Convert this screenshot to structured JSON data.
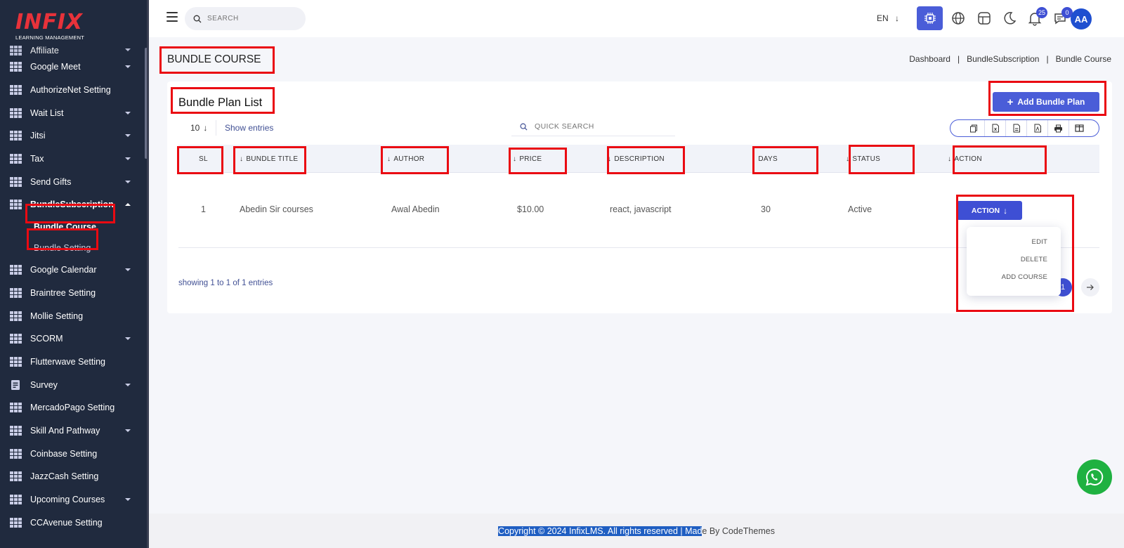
{
  "logo": {
    "word": "INFIX",
    "subtitle": "LEARNING MANAGEMENT"
  },
  "sidebar": {
    "items": [
      {
        "label": "Affiliate",
        "caret": true
      },
      {
        "label": "Google Meet",
        "caret": true
      },
      {
        "label": "AuthorizeNet Setting",
        "caret": false
      },
      {
        "label": "Wait List",
        "caret": true
      },
      {
        "label": "Jitsi",
        "caret": true
      },
      {
        "label": "Tax",
        "caret": true
      },
      {
        "label": "Send Gifts",
        "caret": true
      },
      {
        "label": "BundleSubscription",
        "caret": true,
        "expanded": true
      },
      {
        "label": "Google Calendar",
        "caret": true
      },
      {
        "label": "Braintree Setting",
        "caret": false
      },
      {
        "label": "Mollie Setting",
        "caret": false
      },
      {
        "label": "SCORM",
        "caret": true
      },
      {
        "label": "Flutterwave Setting",
        "caret": false
      },
      {
        "label": "Survey",
        "caret": true
      },
      {
        "label": "MercadoPago Setting",
        "caret": false
      },
      {
        "label": "Skill And Pathway",
        "caret": true
      },
      {
        "label": "Coinbase Setting",
        "caret": false
      },
      {
        "label": "JazzCash Setting",
        "caret": false
      },
      {
        "label": "Upcoming Courses",
        "caret": true
      },
      {
        "label": "CCAvenue Setting",
        "caret": false
      }
    ],
    "subitems": [
      {
        "label": "Bundle Course",
        "active": true
      },
      {
        "label": "Bundle Setting",
        "active": false
      }
    ]
  },
  "topbar": {
    "search_placeholder": "SEARCH",
    "language": "EN",
    "notifications_count": "25",
    "messages_count": "0",
    "avatar_initials": "AA"
  },
  "page": {
    "title": "BUNDLE COURSE",
    "breadcrumbs": [
      "Dashboard",
      "BundleSubscription",
      "Bundle Course"
    ]
  },
  "card": {
    "title": "Bundle Plan List",
    "add_button": "Add Bundle Plan",
    "entries_value": "10",
    "entries_label": "Show entries",
    "quick_search_placeholder": "QUICK SEARCH",
    "columns": [
      "SL",
      "BUNDLE TITLE",
      "AUTHOR",
      "PRICE",
      "DESCRIPTION",
      "DAYS",
      "STATUS",
      "ACTION"
    ],
    "rows": [
      {
        "sl": "1",
        "title": "Abedin Sir courses",
        "author": "Awal Abedin",
        "price": "$10.00",
        "description": "react, javascript",
        "days": "30",
        "status": "Active"
      }
    ],
    "action_button": "ACTION",
    "action_menu": [
      "EDIT",
      "DELETE",
      "ADD COURSE"
    ],
    "showing": "showing 1 to 1 of 1 entries",
    "current_page": "1"
  },
  "footer": {
    "highlighted": "Copyright © 2024 InfixLMS. All rights reserved | Mad",
    "rest": "e By CodeThemes"
  },
  "colors": {
    "sidebar": "#202a3e",
    "primary": "#4a5dd8",
    "annotation": "#ea0a12",
    "whatsapp": "#1fb141"
  }
}
